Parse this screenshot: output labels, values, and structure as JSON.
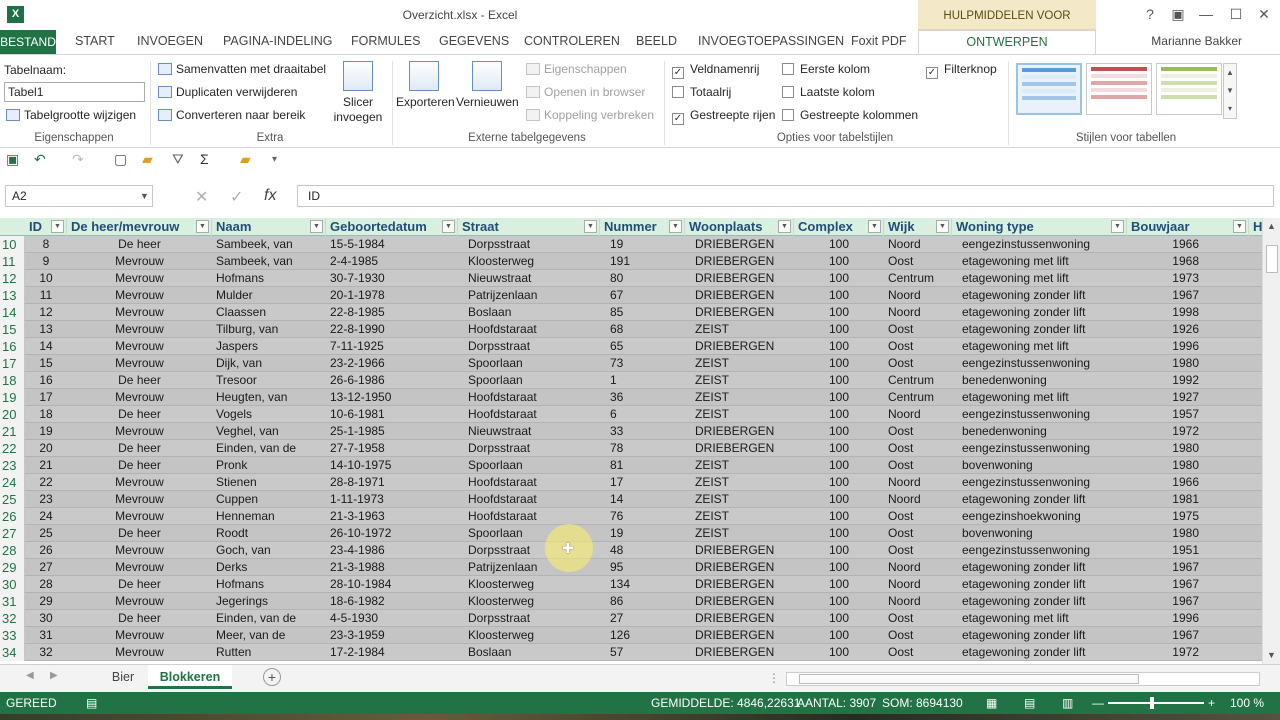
{
  "window": {
    "app_icon": "X",
    "title": "Overzicht.xlsx - Excel",
    "context_tools": "HULPMIDDELEN VOOR TABELLEN",
    "controls": [
      "?",
      "▣",
      "—",
      "☐",
      "✕"
    ]
  },
  "tabs": [
    {
      "label": "BESTAND"
    },
    {
      "label": "START"
    },
    {
      "label": "INVOEGEN"
    },
    {
      "label": "PAGINA-INDELING"
    },
    {
      "label": "FORMULES"
    },
    {
      "label": "GEGEVENS"
    },
    {
      "label": "CONTROLEREN"
    },
    {
      "label": "BEELD"
    },
    {
      "label": "INVOEGTOEPASSINGEN"
    },
    {
      "label": "Foxit PDF"
    },
    {
      "label": "ONTWERPEN"
    }
  ],
  "user": "Marianne Bakker",
  "ribbon": {
    "properties": {
      "table_name_label": "Tabelnaam:",
      "table_name_value": "Tabel1",
      "resize": "Tabelgrootte wijzigen",
      "group": "Eigenschappen"
    },
    "extra": {
      "pivot": "Samenvatten met draaitabel",
      "dupes": "Duplicaten verwijderen",
      "convert": "Converteren naar bereik",
      "slicer": "Slicer invoegen",
      "group": "Extra"
    },
    "external": {
      "export": "Exporteren",
      "refresh": "Vernieuwen",
      "props": "Eigenschappen",
      "browser": "Openen in browser",
      "unlink": "Koppeling verbreken",
      "group": "Externe tabelgegevens"
    },
    "options": {
      "header_row": "Veldnamenrij",
      "total_row": "Totaalrij",
      "banded_rows": "Gestreepte rijen",
      "first_col": "Eerste kolom",
      "last_col": "Laatste kolom",
      "banded_cols": "Gestreepte kolommen",
      "filter_btn": "Filterknop",
      "group": "Opties voor tabelstijlen"
    },
    "styles": {
      "group": "Stijlen voor tabellen",
      "colors": [
        "#5b9bd5",
        "#c0504d",
        "#9bbb59"
      ]
    }
  },
  "formula_bar": {
    "name_box": "A2",
    "content": "ID",
    "fx": "fx"
  },
  "table": {
    "headers": [
      "ID",
      "De heer/mevrouw",
      "Naam",
      "Geboortedatum",
      "Straat",
      "Nummer",
      "Woonplaats",
      "Complex",
      "Wijk",
      "Woning type",
      "Bouwjaar",
      "H"
    ],
    "rows": [
      [
        "10",
        "8",
        "De heer",
        "Sambeek, van",
        "15-5-1984",
        "Dorpsstraat",
        "19",
        "DRIEBERGEN",
        "100",
        "Noord",
        "eengezinstussenwoning",
        "1966"
      ],
      [
        "11",
        "9",
        "Mevrouw",
        "Sambeek, van",
        "2-4-1985",
        "Kloosterweg",
        "191",
        "DRIEBERGEN",
        "100",
        "Oost",
        "etagewoning met lift",
        "1968"
      ],
      [
        "12",
        "10",
        "Mevrouw",
        "Hofmans",
        "30-7-1930",
        "Nieuwstraat",
        "80",
        "DRIEBERGEN",
        "100",
        "Centrum",
        "etagewoning met lift",
        "1973"
      ],
      [
        "13",
        "11",
        "Mevrouw",
        "Mulder",
        "20-1-1978",
        "Patrijzenlaan",
        "67",
        "DRIEBERGEN",
        "100",
        "Noord",
        "etagewoning zonder lift",
        "1967"
      ],
      [
        "14",
        "12",
        "Mevrouw",
        "Claassen",
        "22-8-1985",
        "Boslaan",
        "85",
        "DRIEBERGEN",
        "100",
        "Noord",
        "etagewoning zonder lift",
        "1998"
      ],
      [
        "15",
        "13",
        "Mevrouw",
        "Tilburg, van",
        "22-8-1990",
        "Hoofdstaraat",
        "68",
        "ZEIST",
        "100",
        "Oost",
        "etagewoning zonder lift",
        "1926"
      ],
      [
        "16",
        "14",
        "Mevrouw",
        "Jaspers",
        "7-11-1925",
        "Dorpsstraat",
        "65",
        "DRIEBERGEN",
        "100",
        "Oost",
        "etagewoning met lift",
        "1996"
      ],
      [
        "17",
        "15",
        "Mevrouw",
        "Dijk, van",
        "23-2-1966",
        "Spoorlaan",
        "73",
        "ZEIST",
        "100",
        "Oost",
        "eengezinstussenwoning",
        "1980"
      ],
      [
        "18",
        "16",
        "De heer",
        "Tresoor",
        "26-6-1986",
        "Spoorlaan",
        "1",
        "ZEIST",
        "100",
        "Centrum",
        "benedenwoning",
        "1992"
      ],
      [
        "19",
        "17",
        "Mevrouw",
        "Heugten, van",
        "13-12-1950",
        "Hoofdstaraat",
        "36",
        "ZEIST",
        "100",
        "Centrum",
        "etagewoning met lift",
        "1927"
      ],
      [
        "20",
        "18",
        "De heer",
        "Vogels",
        "10-6-1981",
        "Hoofdstaraat",
        "6",
        "ZEIST",
        "100",
        "Noord",
        "eengezinstussenwoning",
        "1957"
      ],
      [
        "21",
        "19",
        "Mevrouw",
        "Veghel, van",
        "25-1-1985",
        "Nieuwstraat",
        "33",
        "DRIEBERGEN",
        "100",
        "Oost",
        "benedenwoning",
        "1972"
      ],
      [
        "22",
        "20",
        "De heer",
        "Einden, van de",
        "27-7-1958",
        "Dorpsstraat",
        "78",
        "DRIEBERGEN",
        "100",
        "Oost",
        "eengezinstussenwoning",
        "1980"
      ],
      [
        "23",
        "21",
        "De heer",
        "Pronk",
        "14-10-1975",
        "Spoorlaan",
        "81",
        "ZEIST",
        "100",
        "Oost",
        "bovenwoning",
        "1980"
      ],
      [
        "24",
        "22",
        "Mevrouw",
        "Stienen",
        "28-8-1971",
        "Hoofdstaraat",
        "17",
        "ZEIST",
        "100",
        "Noord",
        "eengezinstussenwoning",
        "1966"
      ],
      [
        "25",
        "23",
        "Mevrouw",
        "Cuppen",
        "1-11-1973",
        "Hoofdstaraat",
        "14",
        "ZEIST",
        "100",
        "Noord",
        "etagewoning zonder lift",
        "1981"
      ],
      [
        "26",
        "24",
        "Mevrouw",
        "Henneman",
        "21-3-1963",
        "Hoofdstaraat",
        "76",
        "ZEIST",
        "100",
        "Oost",
        "eengezinshoekwoning",
        "1975"
      ],
      [
        "27",
        "25",
        "De heer",
        "Roodt",
        "26-10-1972",
        "Spoorlaan",
        "19",
        "ZEIST",
        "100",
        "Oost",
        "bovenwoning",
        "1980"
      ],
      [
        "28",
        "26",
        "Mevrouw",
        "Goch, van",
        "23-4-1986",
        "Dorpsstraat",
        "48",
        "DRIEBERGEN",
        "100",
        "Oost",
        "eengezinstussenwoning",
        "1951"
      ],
      [
        "29",
        "27",
        "Mevrouw",
        "Derks",
        "21-3-1988",
        "Patrijzenlaan",
        "95",
        "DRIEBERGEN",
        "100",
        "Noord",
        "etagewoning zonder lift",
        "1967"
      ],
      [
        "30",
        "28",
        "De heer",
        "Hofmans",
        "28-10-1984",
        "Kloosterweg",
        "134",
        "DRIEBERGEN",
        "100",
        "Noord",
        "etagewoning zonder lift",
        "1967"
      ],
      [
        "31",
        "29",
        "Mevrouw",
        "Jegerings",
        "18-6-1982",
        "Kloosterweg",
        "86",
        "DRIEBERGEN",
        "100",
        "Noord",
        "etagewoning zonder lift",
        "1967"
      ],
      [
        "32",
        "30",
        "De heer",
        "Einden, van de",
        "4-5-1930",
        "Dorpsstraat",
        "27",
        "DRIEBERGEN",
        "100",
        "Oost",
        "etagewoning met lift",
        "1996"
      ],
      [
        "33",
        "31",
        "Mevrouw",
        "Meer, van de",
        "23-3-1959",
        "Kloosterweg",
        "126",
        "DRIEBERGEN",
        "100",
        "Oost",
        "etagewoning zonder lift",
        "1967"
      ],
      [
        "34",
        "32",
        "Mevrouw",
        "Rutten",
        "17-2-1984",
        "Boslaan",
        "57",
        "DRIEBERGEN",
        "100",
        "Oost",
        "etagewoning zonder lift",
        "1972"
      ]
    ]
  },
  "sheets": [
    "Bier",
    "Blokkeren"
  ],
  "status": {
    "ready": "GEREED",
    "average": "GEMIDDELDE: 4846,22631",
    "count": "AANTAL: 3907",
    "sum": "SOM: 8694130",
    "zoom": "100 %"
  }
}
